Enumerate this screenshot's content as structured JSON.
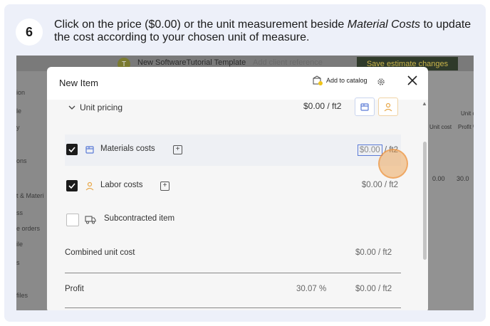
{
  "step": {
    "number": "6",
    "text_before": "Click on the price ($0.00) or the unit measurement beside ",
    "text_em": "Material Costs",
    "text_after": " to update the cost according to your chosen unit of measure."
  },
  "background_app": {
    "avatar_letter": "T",
    "project_title": "New SoftwareTutorial Template",
    "reference_placeholder": "Add client reference",
    "save_button": "Save estimate changes",
    "left_nav": [
      "ion",
      "le",
      "y",
      "ons",
      "t & Materi",
      "ss",
      "e orders",
      "ile",
      "s",
      "files"
    ],
    "right_headers": [
      "Unit c",
      "Unit cost",
      "Profit %"
    ],
    "right_values": [
      "0.00",
      "30.0"
    ]
  },
  "modal": {
    "title": "New Item",
    "add_to_catalog": "Add to catalog",
    "unit_pricing": {
      "label": "Unit pricing",
      "price": "$0.00 / ft2"
    },
    "rows": [
      {
        "label": "Materials costs",
        "checked": true,
        "price": "$0.00",
        "unit": " / ft2"
      },
      {
        "label": "Labor costs",
        "checked": true,
        "value": "$0.00 / ft2"
      },
      {
        "label": "Subcontracted item",
        "checked": false
      }
    ],
    "combined": {
      "label": "Combined unit cost",
      "value": "$0.00 / ft2"
    },
    "profit": {
      "label": "Profit",
      "percent": "30.07 %",
      "value": "$0.00 / ft2"
    }
  },
  "colors": {
    "material_blue": "#5b7bd6",
    "labor_orange": "#e8a84a",
    "highlight_ring": "#ec963c"
  }
}
